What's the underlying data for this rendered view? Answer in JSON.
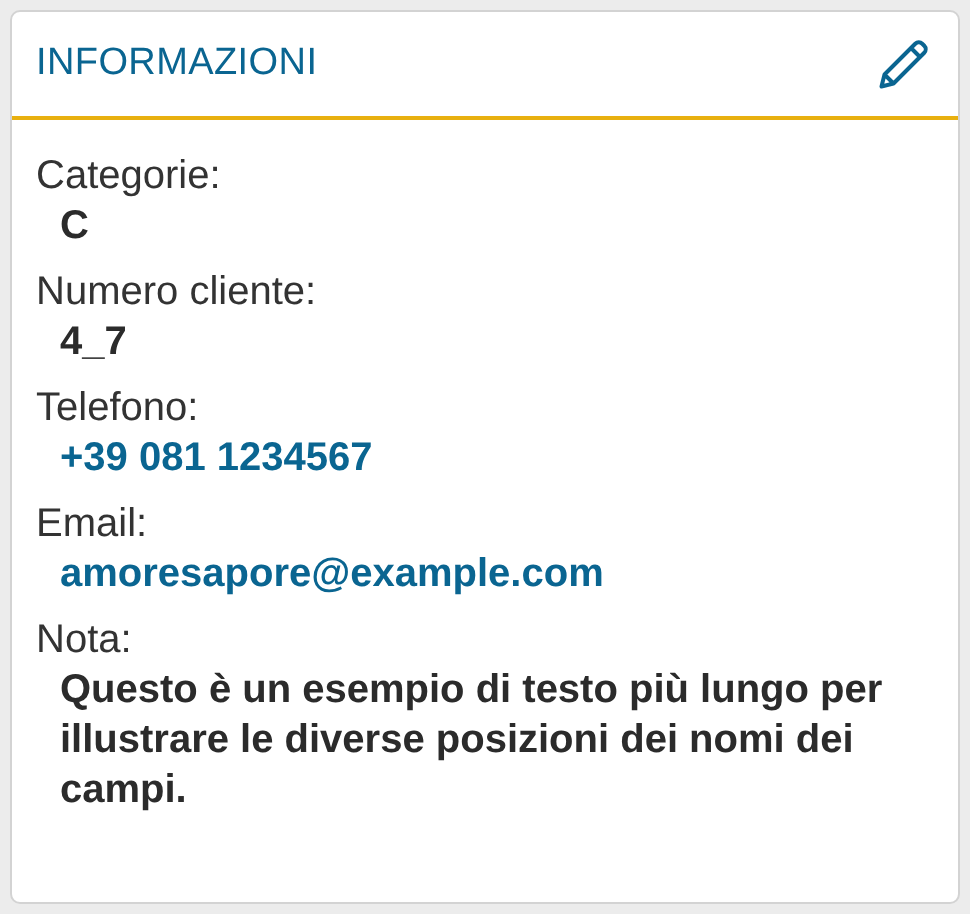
{
  "card": {
    "title": "INFORMAZIONI"
  },
  "fields": [
    {
      "label": "Categorie:",
      "value": "C",
      "kind": "text"
    },
    {
      "label": "Numero cliente:",
      "value": "4_7",
      "kind": "text"
    },
    {
      "label": "Telefono:",
      "value": "+39 081 1234567",
      "kind": "link"
    },
    {
      "label": "Email:",
      "value": "amoresapore@example.com",
      "kind": "link"
    },
    {
      "label": "Nota:",
      "value": "Questo è un esempio di testo più lungo per illustrare le diverse posizioni dei nomi dei campi.",
      "kind": "text"
    }
  ]
}
